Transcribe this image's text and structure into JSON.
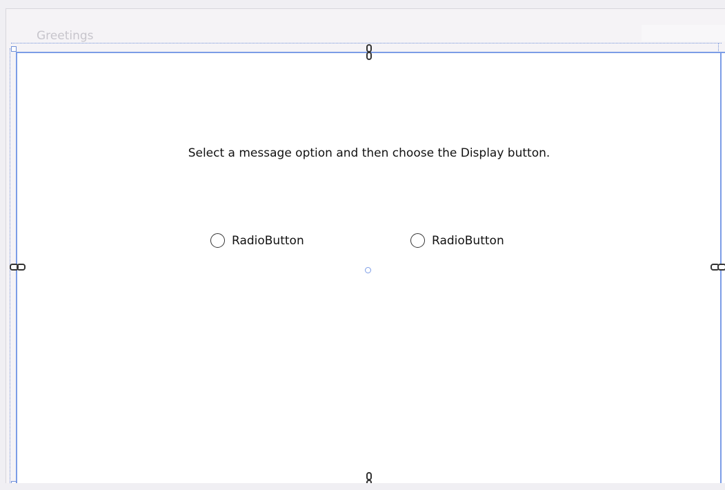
{
  "window": {
    "title": "Greetings"
  },
  "page": {
    "instruction": "Select a message option and then choose the Display button."
  },
  "radio_buttons": [
    {
      "label": "RadioButton",
      "checked": false
    },
    {
      "label": "RadioButton",
      "checked": false
    }
  ],
  "colors": {
    "selection_accent": "#7b9ce6",
    "page_background": "#ffffff",
    "designer_background": "#f0eff3"
  },
  "icons": {
    "anchor": "chain-link-icon",
    "center": "center-handle-icon"
  }
}
